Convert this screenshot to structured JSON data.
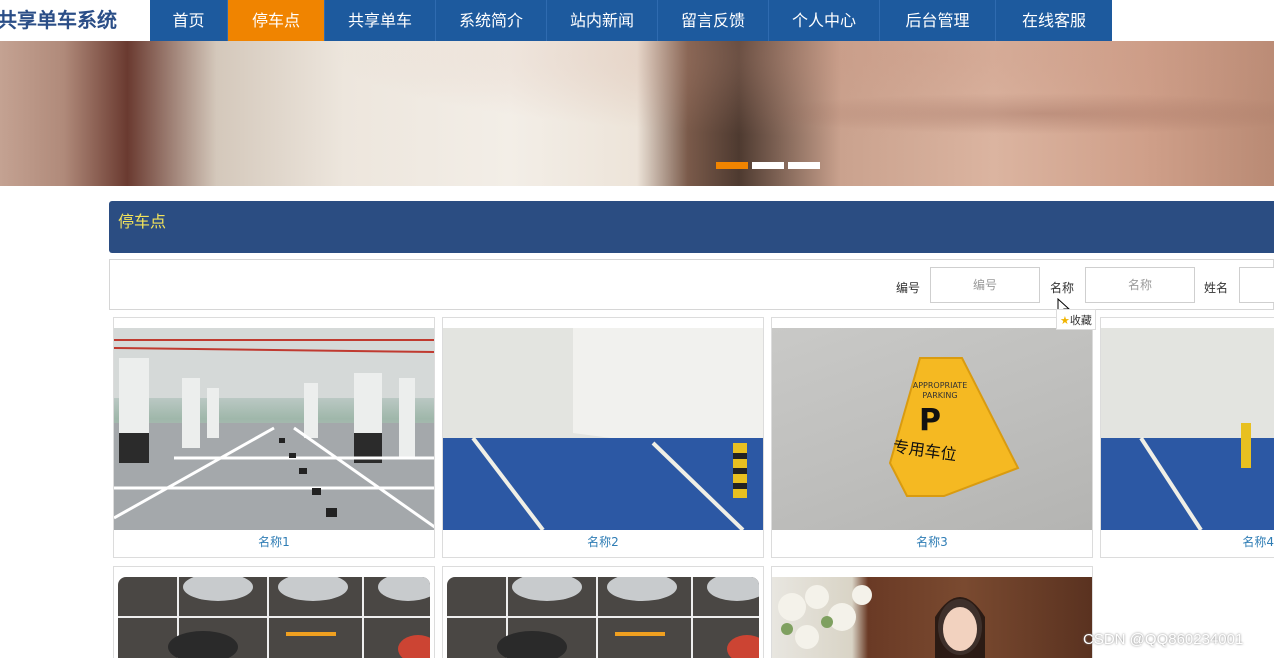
{
  "app": {
    "title": "共享单车系统"
  },
  "nav": {
    "items": [
      {
        "label": "首页",
        "active": false
      },
      {
        "label": "停车点",
        "active": true
      },
      {
        "label": "共享单车",
        "active": false
      },
      {
        "label": "系统简介",
        "active": false
      },
      {
        "label": "站内新闻",
        "active": false
      },
      {
        "label": "留言反馈",
        "active": false
      },
      {
        "label": "个人中心",
        "active": false
      },
      {
        "label": "后台管理",
        "active": false
      },
      {
        "label": "在线客服",
        "active": false
      }
    ]
  },
  "banner": {
    "slide_count": 3,
    "active_slide": 1
  },
  "section": {
    "title": "停车点"
  },
  "search": {
    "fields": [
      {
        "label": "编号",
        "placeholder": "编号"
      },
      {
        "label": "名称",
        "placeholder": "名称"
      },
      {
        "label": "姓名",
        "placeholder": ""
      }
    ]
  },
  "tooltip": {
    "text": "收藏"
  },
  "cards": [
    {
      "name": "名称1",
      "image": "underground-garage"
    },
    {
      "name": "名称2",
      "image": "blue-parking-space"
    },
    {
      "name": "名称3",
      "image": "parking-sign",
      "sign_lines": [
        "APPROPRIATE",
        "PARKING",
        "P",
        "专用车位"
      ]
    },
    {
      "name": "名称4",
      "image": "blue-parking-space"
    },
    {
      "name": "",
      "image": "parking-lot-cars"
    },
    {
      "name": "",
      "image": "parking-lot-cars"
    },
    {
      "name": "",
      "image": "bride-flowers"
    }
  ],
  "watermark": {
    "text": "CSDN @QQ860234001"
  },
  "colors": {
    "nav": "#1d5a9e",
    "active": "#f08400",
    "section": "#2b4d82",
    "section_title": "#f3e45a",
    "card_name": "#2f7db5"
  }
}
